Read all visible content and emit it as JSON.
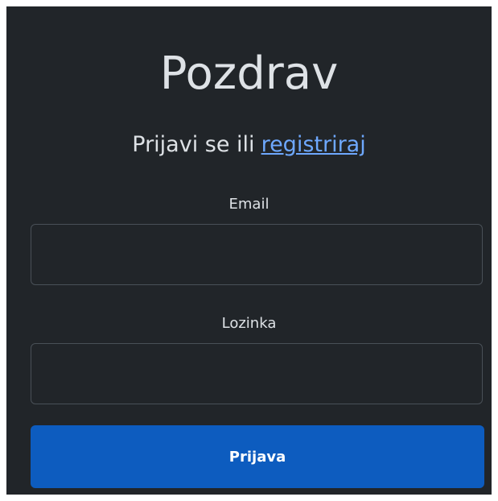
{
  "login": {
    "title": "Pozdrav",
    "subtitle_prefix": "Prijavi se ili",
    "register_link": "registriraj",
    "email_label": "Email",
    "email_value": "",
    "password_label": "Lozinka",
    "password_value": "",
    "submit_label": "Prijava"
  },
  "colors": {
    "page_background": "#ffffff",
    "panel_background": "#212529",
    "text": "#dee2e6",
    "link": "#6ea8fe",
    "input_border": "#495057",
    "button": "#0d5cbf",
    "button_text": "#ffffff"
  }
}
